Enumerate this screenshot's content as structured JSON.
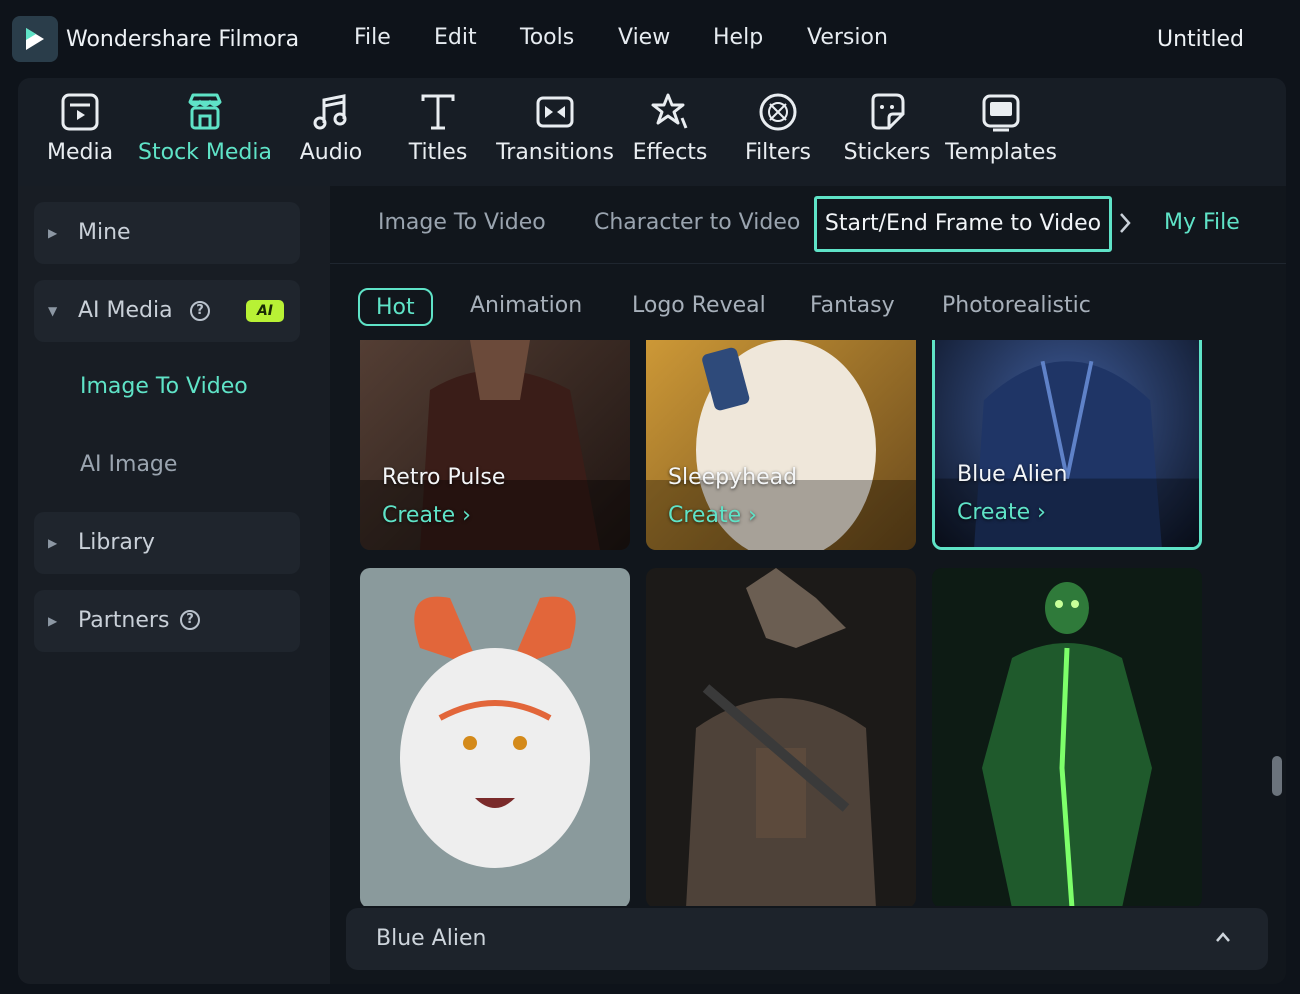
{
  "app": {
    "name": "Wondershare Filmora",
    "project_title": "Untitled",
    "menu": [
      "File",
      "Edit",
      "Tools",
      "View",
      "Help",
      "Version"
    ]
  },
  "toolbar": {
    "active": "Stock Media",
    "items": [
      {
        "label": "Media",
        "icon": "media-icon"
      },
      {
        "label": "Stock Media",
        "icon": "stock-media-icon"
      },
      {
        "label": "Audio",
        "icon": "music-note-icon"
      },
      {
        "label": "Titles",
        "icon": "text-t-icon"
      },
      {
        "label": "Transitions",
        "icon": "transition-icon"
      },
      {
        "label": "Effects",
        "icon": "effects-star-icon"
      },
      {
        "label": "Filters",
        "icon": "filter-icon"
      },
      {
        "label": "Stickers",
        "icon": "sticker-icon"
      },
      {
        "label": "Templates",
        "icon": "template-icon"
      }
    ]
  },
  "sidebar": {
    "mine": "Mine",
    "ai_media": {
      "label": "AI Media",
      "badge": "AI",
      "help": "?"
    },
    "ai_media_items": [
      {
        "label": "Image To Video",
        "active": true
      },
      {
        "label": "AI Image",
        "active": false
      }
    ],
    "library": "Library",
    "partners": {
      "label": "Partners",
      "help": "?"
    }
  },
  "tabs": {
    "items": [
      "Image To Video",
      "Character to Video"
    ],
    "active": "Start/End Frame to Video",
    "my_file": "My File"
  },
  "categories": {
    "active": "Hot",
    "items": [
      "Animation",
      "Logo Reveal",
      "Fantasy",
      "Photorealistic"
    ]
  },
  "cards": [
    {
      "title": "Retro Pulse",
      "action": "Create ›",
      "selected": false
    },
    {
      "title": "Sleepyhead",
      "action": "Create ›",
      "selected": false
    },
    {
      "title": "Blue Alien",
      "action": "Create ›",
      "selected": true
    },
    {
      "title": "",
      "action": "",
      "selected": false
    },
    {
      "title": "",
      "action": "",
      "selected": false
    },
    {
      "title": "",
      "action": "",
      "selected": false
    }
  ],
  "bottom_panel": {
    "label": "Blue Alien"
  },
  "colors": {
    "accent": "#5fe3c7",
    "ai_badge": "#b8f135",
    "background": "#0e131a"
  }
}
